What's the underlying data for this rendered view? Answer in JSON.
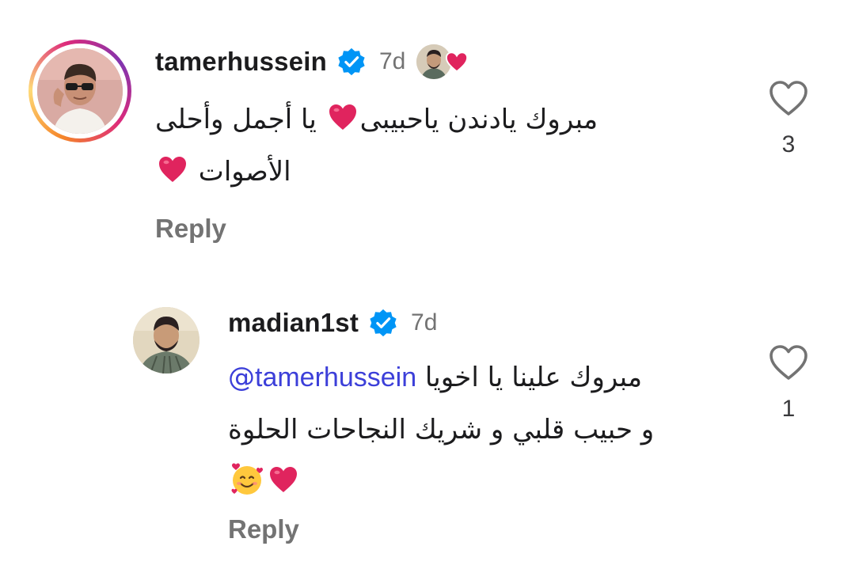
{
  "comments": [
    {
      "username": "tamerhussein",
      "verified": true,
      "timestamp": "7d",
      "liked_by_author": true,
      "text_line1": "مبروك يادندن ياحبيبى",
      "text_line1_after_heart": " يا أجمل وأحلى",
      "text_line2": "الأصوات ",
      "reply_label": "Reply",
      "like_count": "3"
    },
    {
      "username": "madian1st",
      "verified": true,
      "timestamp": "7d",
      "mention_prefix": "@",
      "mention": "tamerhussein",
      "text_line1": "مبروك علينا يا اخويا ",
      "text_line2": "و حبيب قلبي و شريك النجاحات الحلوة",
      "reply_label": "Reply",
      "like_count": "1"
    }
  ],
  "colors": {
    "verified": "#0095f6",
    "heart": "#e0245e",
    "mention": "#3c3fd9",
    "secondary_text": "#737373"
  },
  "icons": [
    "verified-badge-icon",
    "heart-outline-icon",
    "red-heart-emoji",
    "smiling-face-with-hearts-emoji"
  ]
}
